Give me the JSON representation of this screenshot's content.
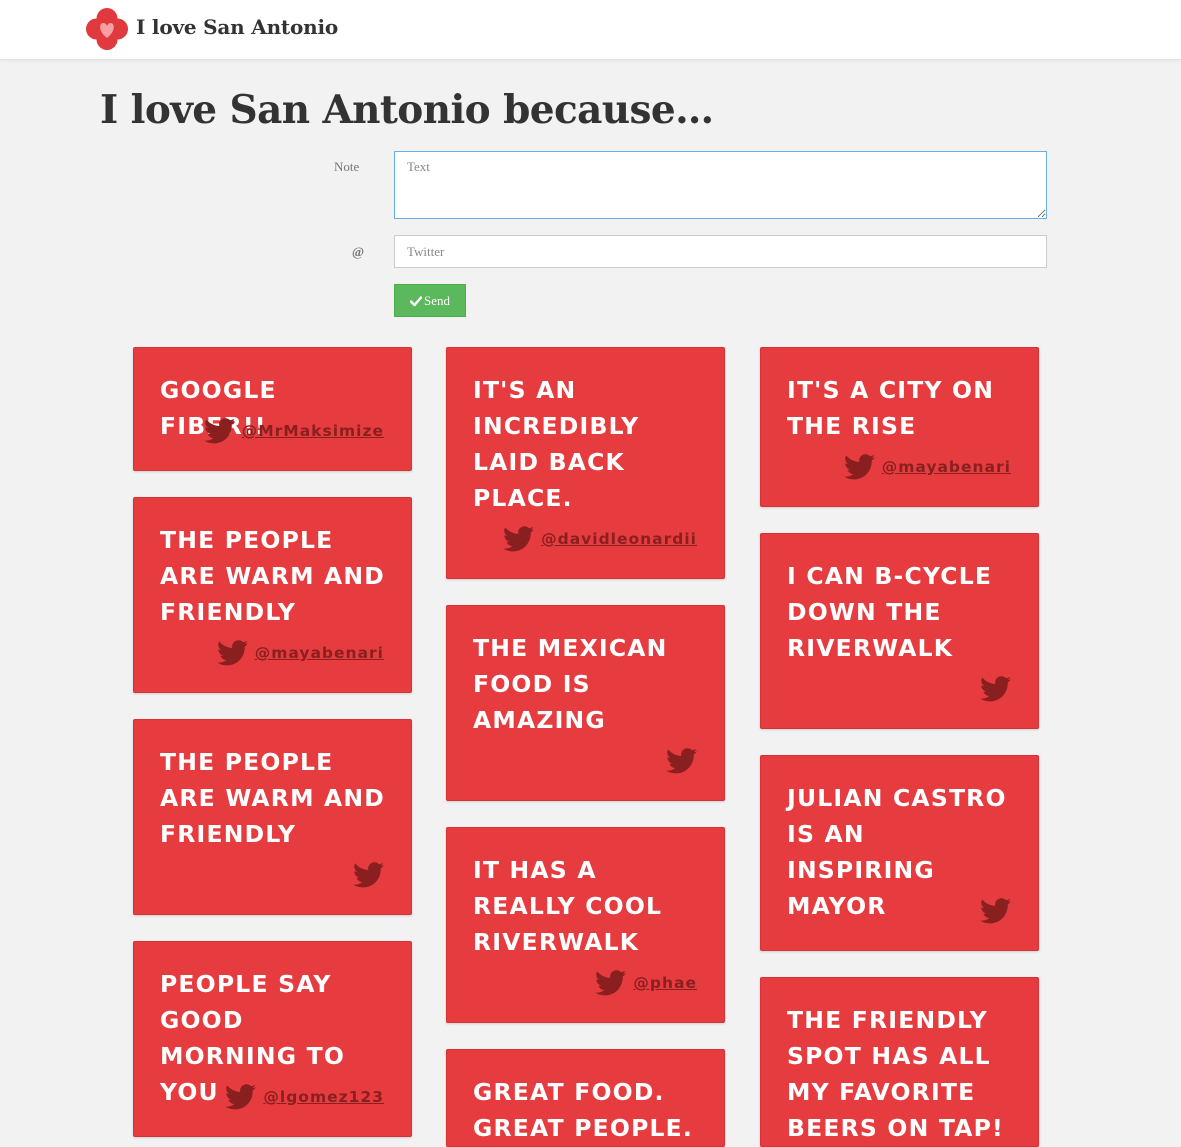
{
  "header": {
    "brand": "I love San Antonio",
    "logo_icon": "heart-quatrefoil-icon"
  },
  "page": {
    "title": "I love San Antonio because…"
  },
  "form": {
    "note_label": "Note",
    "note_placeholder": "Text",
    "twitter_label": "@",
    "twitter_placeholder": "Twitter",
    "send_label": "Send",
    "send_icon": "check-icon"
  },
  "colors": {
    "card": "#e63c3f",
    "send": "#5cb85c",
    "handle": "#8a1f1f",
    "background": "#f2f2f2"
  },
  "cards": [
    {
      "text": "GOOGLE FIBER!!",
      "handle": "@MrMaksimize"
    },
    {
      "text": "THE PEOPLE ARE WARM AND FRIENDLY",
      "handle": "@mayabenari"
    },
    {
      "text": "THE PEOPLE ARE WARM AND FRIENDLY",
      "handle": ""
    },
    {
      "text": "PEOPLE SAY GOOD MORNING TO YOU",
      "handle": "@lgomez123"
    },
    {
      "text": "IT'S AN INCREDIBLY LAID BACK PLACE.",
      "handle": "@davidleonardii"
    },
    {
      "text": "THE MEXICAN FOOD IS AMAZING",
      "handle": ""
    },
    {
      "text": "IT HAS A REALLY COOL RIVERWALK",
      "handle": "@phae"
    },
    {
      "text": "GREAT FOOD. GREAT PEOPLE.",
      "handle": ""
    },
    {
      "text": "IT'S A CITY ON THE RISE",
      "handle": "@mayabenari"
    },
    {
      "text": "I CAN B-CYCLE DOWN THE RIVERWALK",
      "handle": ""
    },
    {
      "text": "JULIAN CASTRO IS AN INSPIRING MAYOR",
      "handle": ""
    },
    {
      "text": "THE FRIENDLY SPOT HAS ALL MY FAVORITE BEERS ON TAP!",
      "handle": ""
    }
  ]
}
